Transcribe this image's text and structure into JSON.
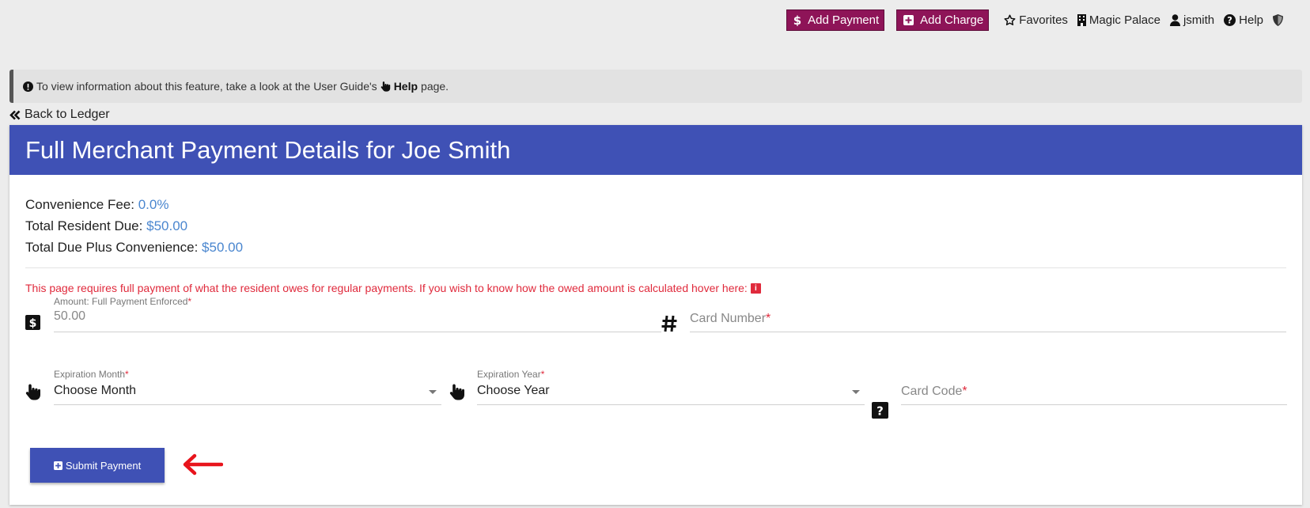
{
  "topbar": {
    "add_payment": "Add Payment",
    "add_charge": "Add Charge",
    "favorites": "Favorites",
    "property": "Magic Palace",
    "user": "jsmith",
    "help": "Help"
  },
  "info": {
    "text_before": "To view information about this feature, take a look at the User Guide's",
    "help_link": "Help",
    "text_after": "page."
  },
  "back_link": "Back to Ledger",
  "card": {
    "title": "Full Merchant Payment Details for Joe Smith",
    "summary": {
      "fee_label": "Convenience Fee:",
      "fee_value": "0.0%",
      "due_label": "Total Resident Due:",
      "due_value": "$50.00",
      "total_label": "Total Due Plus Convenience:",
      "total_value": "$50.00"
    },
    "warning": "This page requires full payment of what the resident owes for regular payments. If you wish to know how the owed amount is calculated hover here:",
    "warning_badge": "i"
  },
  "form": {
    "amount_label": "Amount: Full Payment Enforced",
    "amount_value": "50.00",
    "card_number_placeholder": "Card Number",
    "exp_month_label": "Expiration Month",
    "exp_month_value": "Choose Month",
    "exp_year_label": "Expiration Year",
    "exp_year_value": "Choose Year",
    "card_code_placeholder": "Card Code",
    "required_mark": "*",
    "submit_label": "Submit Payment"
  },
  "colors": {
    "header_blue": "#3f51b5",
    "topbar_button": "#8e1458",
    "value_blue": "#4a86cf",
    "warning_red": "#e02a3c",
    "arrow_red": "#e8141c"
  },
  "icons": [
    "dollar-icon",
    "plus-square-icon",
    "star-icon",
    "building-icon",
    "user-icon",
    "question-circle-icon",
    "shield-icon",
    "exclamation-circle-icon",
    "pointer-hand-icon",
    "double-chevron-left-icon",
    "hashtag-icon",
    "question-square-icon",
    "arrow-left-icon"
  ]
}
